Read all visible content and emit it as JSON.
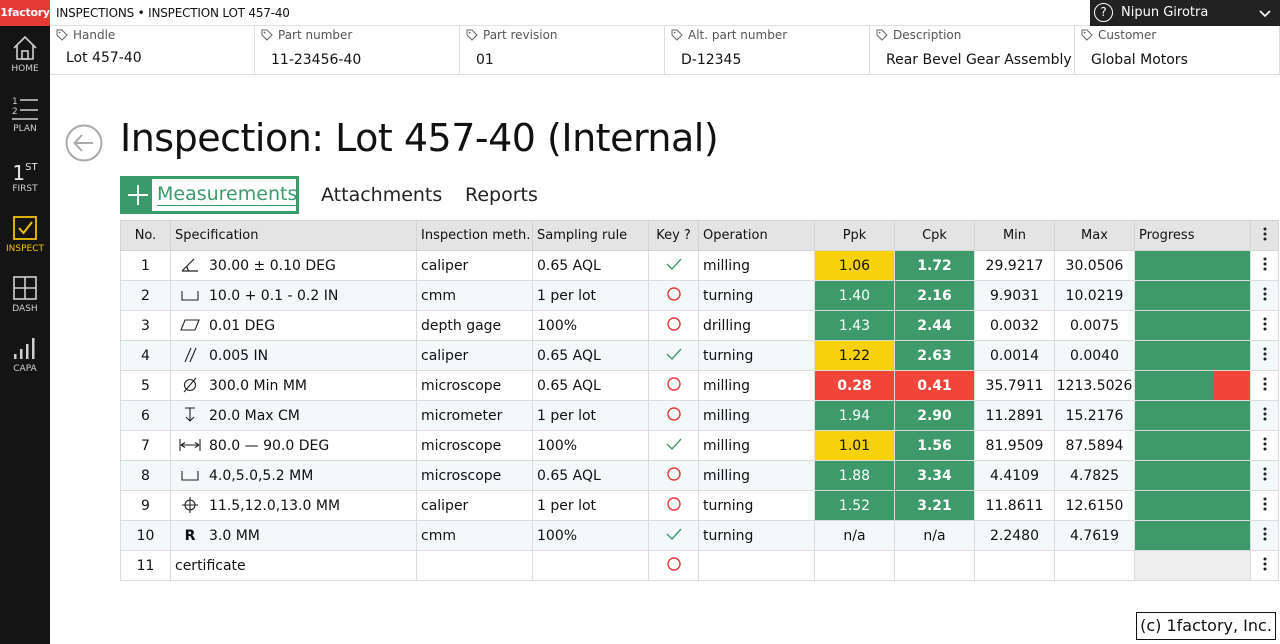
{
  "app": {
    "logo": "1factory",
    "breadcrumb": "INSPECTIONS • INSPECTION LOT 457-40"
  },
  "user": {
    "name": "Nipun Girotra",
    "help": "?"
  },
  "sidebar": {
    "items": [
      {
        "label": "HOME",
        "icon": "home-icon"
      },
      {
        "label": "PLAN",
        "icon": "list-icon"
      },
      {
        "label": "FIRST",
        "icon": "first-icon",
        "glyph": "1",
        "sup": "ST"
      },
      {
        "label": "INSPECT",
        "icon": "check-box-icon",
        "active": true
      },
      {
        "label": "DASH",
        "icon": "grid-icon"
      },
      {
        "label": "CAPA",
        "icon": "bars-icon"
      }
    ]
  },
  "fields": [
    {
      "label": "Handle",
      "value": "Lot 457-40"
    },
    {
      "label": "Part number",
      "value": "11-23456-40"
    },
    {
      "label": "Part revision",
      "value": "01"
    },
    {
      "label": "Alt. part number",
      "value": "D-12345"
    },
    {
      "label": "Description",
      "value": "Rear Bevel Gear Assembly"
    },
    {
      "label": "Customer",
      "value": "Global Motors"
    }
  ],
  "page": {
    "title": "Inspection: Lot 457-40 (Internal)"
  },
  "tabs": {
    "measurements": "Measurements",
    "attachments": "Attachments",
    "reports": "Reports"
  },
  "table": {
    "headers": [
      "No.",
      "Specification",
      "Inspection meth…",
      "Sampling rule",
      "Key ?",
      "Operation",
      "Ppk",
      "Cpk",
      "Min",
      "Max",
      "Progress"
    ],
    "colors": {
      "green": "#3f9a6b",
      "yellow": "#f7d20c",
      "red": "#f04538"
    },
    "rows": [
      {
        "no": "1",
        "symbol": "angularity-icon",
        "spec": "30.00 ± 0.10  DEG",
        "method": "caliper",
        "sampling": "0.65 AQL",
        "key": "check",
        "operation": "milling",
        "ppk": "1.06",
        "ppk_status": "yellow",
        "cpk": "1.72",
        "cpk_status": "green",
        "min": "29.9217",
        "max": "30.0506",
        "progress": "green"
      },
      {
        "no": "2",
        "symbol": "counterbore-icon",
        "spec": "10.0 + 0.1 - 0.2  IN",
        "method": "cmm",
        "sampling": "1 per lot",
        "key": "circle",
        "operation": "turning",
        "ppk": "1.40",
        "ppk_status": "green",
        "cpk": "2.16",
        "cpk_status": "green",
        "min": "9.9031",
        "max": "10.0219",
        "progress": "green"
      },
      {
        "no": "3",
        "symbol": "flatness-icon",
        "spec": "0.01  DEG",
        "method": "depth gage",
        "sampling": "100%",
        "key": "circle",
        "operation": "drilling",
        "ppk": "1.43",
        "ppk_status": "green",
        "cpk": "2.44",
        "cpk_status": "green",
        "min": "0.0032",
        "max": "0.0075",
        "progress": "green"
      },
      {
        "no": "4",
        "symbol": "parallelism-icon",
        "spec": "0.005  IN",
        "method": "caliper",
        "sampling": "0.65 AQL",
        "key": "check",
        "operation": "turning",
        "ppk": "1.22",
        "ppk_status": "yellow",
        "cpk": "2.63",
        "cpk_status": "green",
        "min": "0.0014",
        "max": "0.0040",
        "progress": "green"
      },
      {
        "no": "5",
        "symbol": "diameter-icon",
        "spec": "300.0 Min  MM",
        "method": "microscope",
        "sampling": "0.65 AQL",
        "key": "circle",
        "operation": "milling",
        "ppk": "0.28",
        "ppk_status": "red",
        "cpk": "0.41",
        "cpk_status": "red",
        "min": "35.7911",
        "max": "1213.5026",
        "progress": "mixed"
      },
      {
        "no": "6",
        "symbol": "depth-icon",
        "spec": "20.0 Max  CM",
        "method": "micrometer",
        "sampling": "1 per lot",
        "key": "circle",
        "operation": "milling",
        "ppk": "1.94",
        "ppk_status": "green",
        "cpk": "2.90",
        "cpk_status": "green",
        "min": "11.2891",
        "max": "15.2176",
        "progress": "green"
      },
      {
        "no": "7",
        "symbol": "between-icon",
        "spec": "80.0 — 90.0  DEG",
        "method": "microscope",
        "sampling": "100%",
        "key": "check",
        "operation": "milling",
        "ppk": "1.01",
        "ppk_status": "yellow",
        "cpk": "1.56",
        "cpk_status": "green",
        "min": "81.9509",
        "max": "87.5894",
        "progress": "green"
      },
      {
        "no": "8",
        "symbol": "counterbore-icon",
        "spec": "4.0,5.0,5.2  MM",
        "method": "microscope",
        "sampling": "0.65 AQL",
        "key": "circle",
        "operation": "milling",
        "ppk": "1.88",
        "ppk_status": "green",
        "cpk": "3.34",
        "cpk_status": "green",
        "min": "4.4109",
        "max": "4.7825",
        "progress": "green"
      },
      {
        "no": "9",
        "symbol": "position-icon",
        "spec": "11.5,12.0,13.0  MM",
        "method": "caliper",
        "sampling": "1 per lot",
        "key": "circle",
        "operation": "turning",
        "ppk": "1.52",
        "ppk_status": "green",
        "cpk": "3.21",
        "cpk_status": "green",
        "min": "11.8611",
        "max": "12.6150",
        "progress": "green"
      },
      {
        "no": "10",
        "symbol": "radius-icon",
        "symbol_text": "R",
        "spec": "3.0  MM",
        "method": "cmm",
        "sampling": "100%",
        "key": "check",
        "operation": "turning",
        "ppk": "n/a",
        "ppk_status": "none",
        "cpk": "n/a",
        "cpk_status": "none",
        "min": "2.2480",
        "max": "4.7619",
        "progress": "green"
      },
      {
        "no": "11",
        "symbol": "",
        "spec": "certificate",
        "method": "",
        "sampling": "",
        "key": "circle",
        "operation": "",
        "ppk": "",
        "ppk_status": "none",
        "cpk": "",
        "cpk_status": "none",
        "min": "",
        "max": "",
        "progress": "empty"
      }
    ]
  },
  "footer": {
    "copyright": "(c) 1factory, Inc."
  }
}
